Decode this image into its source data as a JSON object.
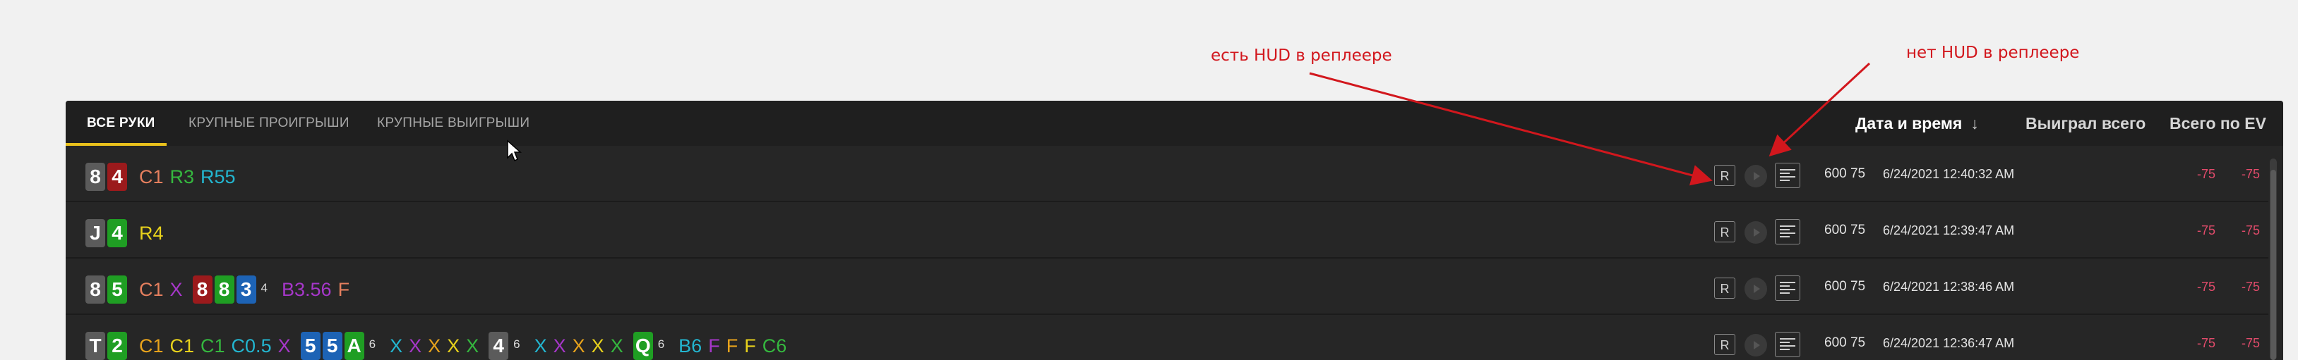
{
  "annotations": {
    "left": "есть HUD в реплеере",
    "right": "нет HUD в реплеере"
  },
  "tabs": [
    {
      "label": "ВСЕ РУКИ",
      "active": true
    },
    {
      "label": "КРУПНЫЕ ПРОИГРЫШИ",
      "active": false
    },
    {
      "label": "КРУПНЫЕ ВЫИГРЫШИ",
      "active": false
    }
  ],
  "columns": {
    "date": "Дата и время",
    "sort_indicator": "↓",
    "won": "Выиграл всего",
    "ev": "Всего по EV"
  },
  "colors": {
    "accent": "#e8c01c",
    "negative": "#e24b6b",
    "annotation": "#d2171d",
    "card_gray": "#5b5b5b",
    "card_red": "#9b1a1c",
    "card_green": "#1f9e23",
    "card_blue": "#1d63b5"
  },
  "icons": {
    "replay_r": "R",
    "play": "play-icon",
    "log": "hand-history-icon"
  },
  "rows": [
    {
      "hole_cards": [
        {
          "rank": "8",
          "suit": "gray"
        },
        {
          "rank": "4",
          "suit": "red"
        }
      ],
      "actions": [
        {
          "t": "C1",
          "c": "#e57f5e"
        },
        {
          "t": "R3",
          "c": "#35b83f"
        },
        {
          "t": "R55",
          "c": "#23b6d0"
        }
      ],
      "stakes": "600 75",
      "datetime": "6/24/2021 12:40:32 AM",
      "won": "-75",
      "ev": "-75"
    },
    {
      "hole_cards": [
        {
          "rank": "J",
          "suit": "gray"
        },
        {
          "rank": "4",
          "suit": "green"
        }
      ],
      "actions": [
        {
          "t": "R4",
          "c": "#e8d21c"
        }
      ],
      "stakes": "600 75",
      "datetime": "6/24/2021 12:39:47 AM",
      "won": "-75",
      "ev": "-75"
    },
    {
      "hole_cards": [
        {
          "rank": "8",
          "suit": "gray"
        },
        {
          "rank": "5",
          "suit": "green"
        }
      ],
      "actions": [
        {
          "t": "C1",
          "c": "#e57f5e"
        },
        {
          "t": "X",
          "c": "#a637c9"
        }
      ],
      "board": {
        "cards": [
          {
            "rank": "8",
            "suit": "red"
          },
          {
            "rank": "8",
            "suit": "green"
          },
          {
            "rank": "3",
            "suit": "blue"
          }
        ],
        "count": "4"
      },
      "board_actions": [
        {
          "t": "B3.56",
          "c": "#a637c9"
        },
        {
          "t": "F",
          "c": "#e57f5e"
        }
      ],
      "stakes": "600 75",
      "datetime": "6/24/2021 12:38:46 AM",
      "won": "-75",
      "ev": "-75"
    },
    {
      "hole_cards": [
        {
          "rank": "T",
          "suit": "gray"
        },
        {
          "rank": "2",
          "suit": "green"
        }
      ],
      "actions": [
        {
          "t": "C1",
          "c": "#e8a31c"
        },
        {
          "t": "C1",
          "c": "#e8d21c"
        },
        {
          "t": "C1",
          "c": "#35b83f"
        },
        {
          "t": "C0.5",
          "c": "#23b6d0"
        },
        {
          "t": "X",
          "c": "#a637c9"
        }
      ],
      "streets": [
        {
          "cards": [
            {
              "rank": "5",
              "suit": "blue"
            },
            {
              "rank": "5",
              "suit": "blue"
            },
            {
              "rank": "A",
              "suit": "green"
            }
          ],
          "count": "6",
          "actions": [
            {
              "t": "X",
              "c": "#23b6d0"
            },
            {
              "t": "X",
              "c": "#a637c9"
            },
            {
              "t": "X",
              "c": "#e8a31c"
            },
            {
              "t": "X",
              "c": "#e8d21c"
            },
            {
              "t": "X",
              "c": "#35b83f"
            }
          ]
        },
        {
          "cards": [
            {
              "rank": "4",
              "suit": "gray"
            }
          ],
          "count": "6",
          "actions": [
            {
              "t": "X",
              "c": "#23b6d0"
            },
            {
              "t": "X",
              "c": "#a637c9"
            },
            {
              "t": "X",
              "c": "#e8a31c"
            },
            {
              "t": "X",
              "c": "#e8d21c"
            },
            {
              "t": "X",
              "c": "#35b83f"
            }
          ]
        },
        {
          "cards": [
            {
              "rank": "Q",
              "suit": "green"
            }
          ],
          "count": "6",
          "actions": [
            {
              "t": "B6",
              "c": "#23b6d0"
            },
            {
              "t": "F",
              "c": "#a637c9"
            },
            {
              "t": "F",
              "c": "#e8a31c"
            },
            {
              "t": "F",
              "c": "#e8d21c"
            },
            {
              "t": "C6",
              "c": "#35b83f"
            }
          ]
        }
      ],
      "stakes": "600 75",
      "datetime": "6/24/2021 12:36:47 AM",
      "won": "-75",
      "ev": "-75"
    }
  ]
}
